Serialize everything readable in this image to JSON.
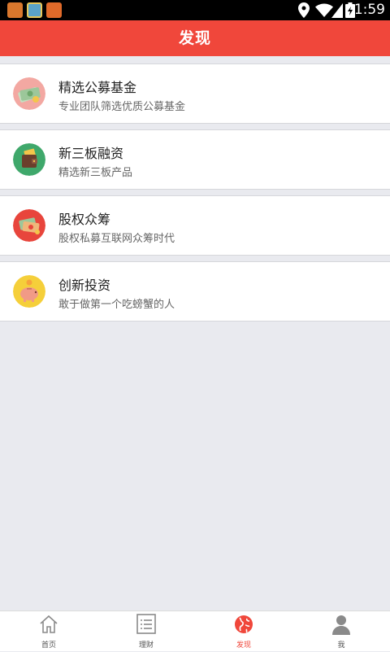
{
  "status_bar": {
    "time": "1:59",
    "icons": [
      "location-icon",
      "wifi-icon",
      "signal-icon",
      "battery-icon"
    ]
  },
  "header": {
    "title": "发现"
  },
  "items": [
    {
      "title": "精选公募基金",
      "subtitle": "专业团队筛选优质公募基金",
      "icon": "money-stack-icon"
    },
    {
      "title": "新三板融资",
      "subtitle": "精选新三板产品",
      "icon": "wallet-icon"
    },
    {
      "title": "股权众筹",
      "subtitle": "股权私募互联网众筹时代",
      "icon": "crowdfunding-icon"
    },
    {
      "title": "创新投资",
      "subtitle": "敢于做第一个吃螃蟹的人",
      "icon": "piggy-bank-icon"
    }
  ],
  "bottom_nav": {
    "active": "发现",
    "items": [
      {
        "label": "首页",
        "icon": "home-icon"
      },
      {
        "label": "理财",
        "icon": "list-icon"
      },
      {
        "label": "发现",
        "icon": "globe-icon"
      },
      {
        "label": "我",
        "icon": "user-icon"
      }
    ]
  },
  "colors": {
    "accent": "#f0473b",
    "background": "#e9eaef",
    "nav_inactive": "#8a8a8a"
  }
}
